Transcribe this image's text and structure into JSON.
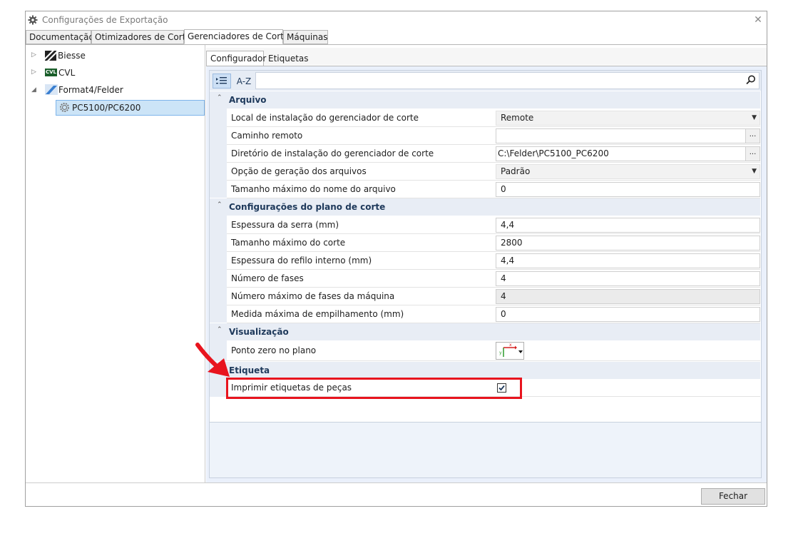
{
  "window": {
    "title": "Configurações de Exportação",
    "close_glyph": "✕"
  },
  "tabs": [
    {
      "label": "Documentação"
    },
    {
      "label": "Otimizadores de Corte"
    },
    {
      "label": "Gerenciadores de Corte"
    },
    {
      "label": "Máquinas"
    }
  ],
  "tree": {
    "items": [
      {
        "label": "Biesse"
      },
      {
        "label": "CVL",
        "logo_text": "CVL"
      },
      {
        "label": "Format4/Felder"
      },
      {
        "label": "PC5100/PC6200"
      }
    ]
  },
  "subtabs": [
    {
      "label": "Configurador"
    },
    {
      "label": "Etiquetas"
    }
  ],
  "toolbar": {
    "sort_label": "A-Z",
    "search_value": ""
  },
  "categories": {
    "arquivo": {
      "label": "Arquivo",
      "rows": [
        {
          "name": "Local de instalação do gerenciador de corte",
          "value": "Remote"
        },
        {
          "name": "Caminho remoto",
          "value": "",
          "button": "..."
        },
        {
          "name": "Diretório de instalação do gerenciador de corte",
          "value": "C:\\Felder\\PC5100_PC6200",
          "button": "..."
        },
        {
          "name": "Opção de geração dos arquivos",
          "value": "Padrão"
        },
        {
          "name": "Tamanho máximo do nome do arquivo",
          "value": "0"
        }
      ]
    },
    "plano": {
      "label": "Configurações do plano de corte",
      "rows": [
        {
          "name": "Espessura da serra (mm)",
          "value": "4,4"
        },
        {
          "name": "Tamanho máximo do corte",
          "value": "2800"
        },
        {
          "name": "Espessura do refilo interno (mm)",
          "value": "4,4"
        },
        {
          "name": "Número de fases",
          "value": "4"
        },
        {
          "name": "Número máximo de fases da máquina",
          "value": "4"
        },
        {
          "name": "Medida máxima de empilhamento (mm)",
          "value": "0"
        }
      ]
    },
    "visualizacao": {
      "label": "Visualização",
      "rows": [
        {
          "name": "Ponto zero no plano",
          "value_icon": "zero-point-axis-icon",
          "axis_x": "x",
          "axis_y": "y"
        }
      ]
    },
    "etiqueta": {
      "label": "Etiqueta",
      "rows": [
        {
          "name": "Imprimir etiquetas de peças",
          "checked": true
        }
      ]
    }
  },
  "footer": {
    "close_label": "Fechar"
  },
  "annotation": {
    "color": "#e8141e"
  }
}
